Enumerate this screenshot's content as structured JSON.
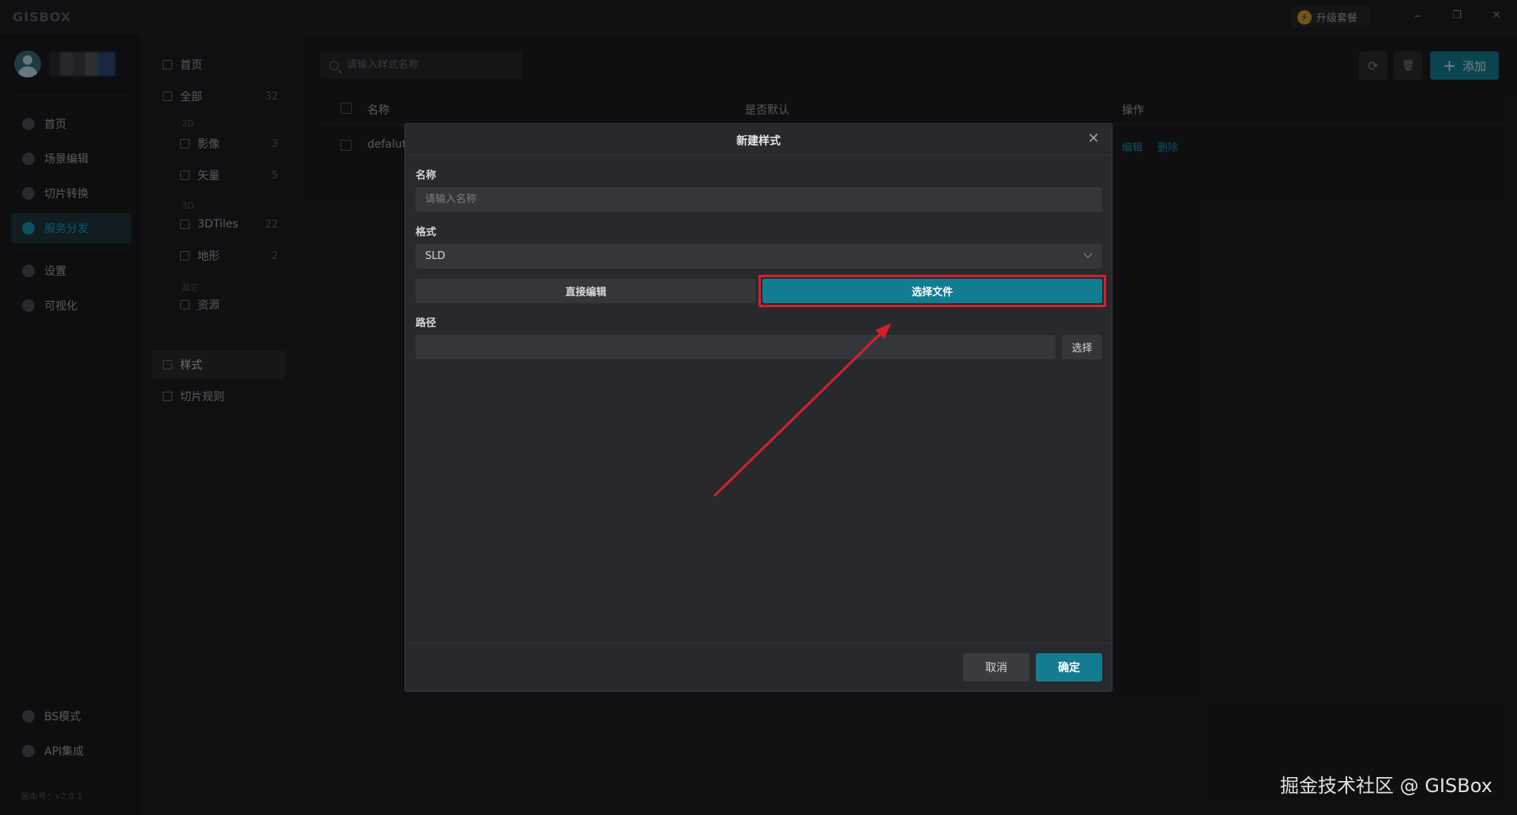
{
  "app": {
    "logo": "GISBOX",
    "upgrade_label": "升级套餐",
    "window_controls": {
      "minimize": "–",
      "restore": "❐",
      "close": "✕"
    }
  },
  "sidebar": {
    "items": [
      {
        "label": "首页",
        "icon": "home-icon"
      },
      {
        "label": "场景编辑",
        "icon": "cube-icon"
      },
      {
        "label": "切片转换",
        "icon": "convert-icon"
      },
      {
        "label": "服务分发",
        "icon": "upload-icon"
      },
      {
        "label": "设置",
        "icon": "gear-icon"
      },
      {
        "label": "可视化",
        "icon": "visual-icon"
      },
      {
        "label": "BS模式",
        "icon": "code-icon"
      },
      {
        "label": "API集成",
        "icon": "link-icon"
      }
    ],
    "version": "版本号：v2.0.1"
  },
  "subsidebar": {
    "home": "首页",
    "all": {
      "label": "全部",
      "count": "32"
    },
    "group_2d": "2D",
    "imagery": {
      "label": "影像",
      "count": "3"
    },
    "vector": {
      "label": "矢量",
      "count": "5"
    },
    "group_3d": "3D",
    "tiles3d": {
      "label": "3DTiles",
      "count": "22"
    },
    "terrain": {
      "label": "地形",
      "count": "2"
    },
    "group_other": "其它",
    "resource": "资源",
    "style": "样式",
    "tile_rules": "切片规则"
  },
  "main": {
    "search_placeholder": "请输入样式名称",
    "refresh_icon": "⟳",
    "delete_icon": "🗑",
    "add_label": "添加",
    "columns": {
      "name": "名称",
      "is_default": "是否默认",
      "actions": "操作"
    },
    "rows": [
      {
        "name": "defalut",
        "edit": "编辑",
        "delete": "删除"
      }
    ]
  },
  "modal": {
    "title": "新建样式",
    "close": "✕",
    "name_label": "名称",
    "name_placeholder": "请输入名称",
    "format_label": "格式",
    "format_value": "SLD",
    "edit_direct": "直接编辑",
    "select_file": "选择文件",
    "path_label": "路径",
    "path_value": "",
    "path_button": "选择",
    "cancel": "取消",
    "confirm": "确定"
  },
  "colors": {
    "accent": "#137c91",
    "highlight": "#d8202a",
    "arrow": "#d8202a"
  },
  "watermark": "掘金技术社区 @ GISBox"
}
